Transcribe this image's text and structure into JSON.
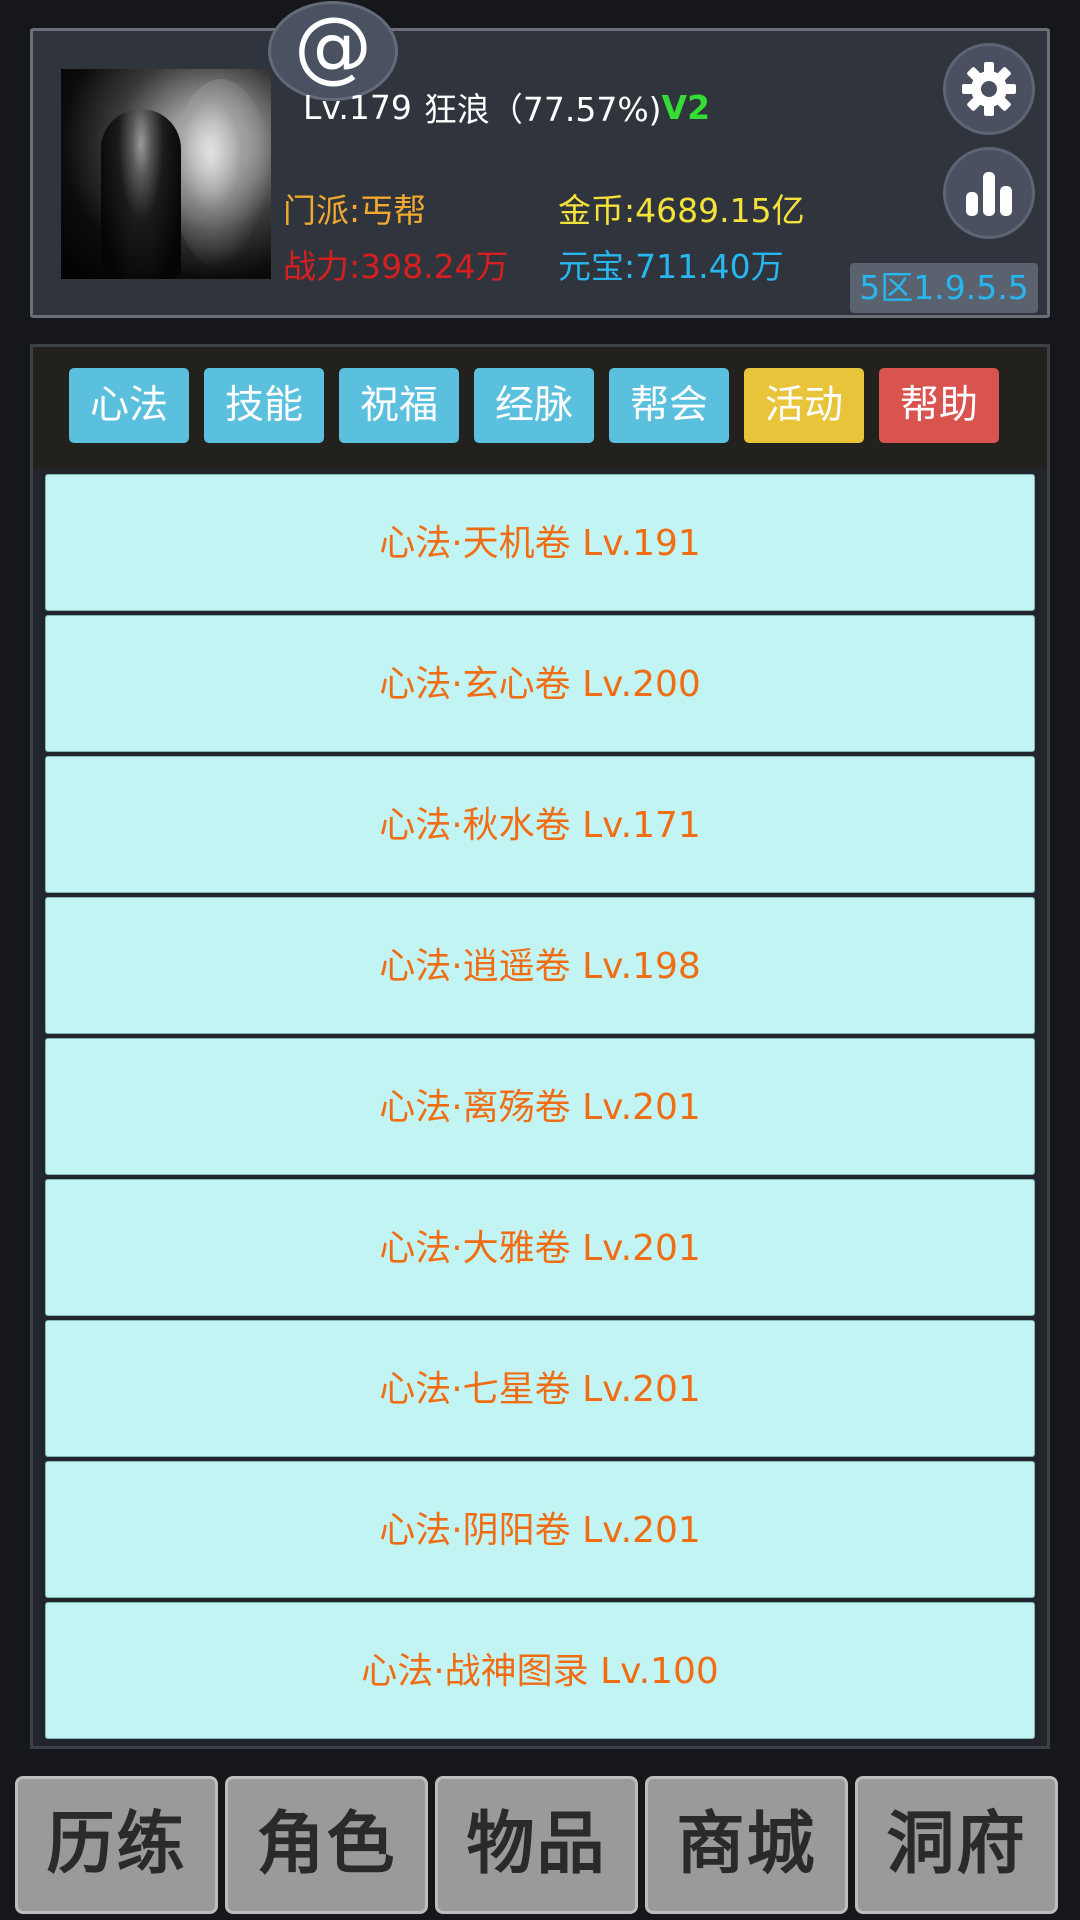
{
  "header": {
    "at_symbol": "@",
    "level": "Lv.179",
    "name": "狂浪",
    "exp_percent": "（77.57%)",
    "vip": "V2",
    "sect": "门派:丐帮",
    "power": "战力:398.24万",
    "gold": "金币:4689.15亿",
    "ingot": "元宝:711.40万",
    "server": "5区1.9.5.5",
    "icons": {
      "settings": "gear-icon",
      "stats": "bar-chart-icon"
    }
  },
  "tabs": [
    {
      "label": "心法",
      "color": "#5bc0de"
    },
    {
      "label": "技能",
      "color": "#5bc0de"
    },
    {
      "label": "祝福",
      "color": "#5bc0de"
    },
    {
      "label": "经脉",
      "color": "#5bc0de"
    },
    {
      "label": "帮会",
      "color": "#5bc0de"
    },
    {
      "label": "活动",
      "color": "#e8c43a"
    },
    {
      "label": "帮助",
      "color": "#d9534f"
    }
  ],
  "skills": [
    "心法·天机卷 Lv.191",
    "心法·玄心卷 Lv.200",
    "心法·秋水卷 Lv.171",
    "心法·逍遥卷 Lv.198",
    "心法·离殇卷 Lv.201",
    "心法·大雅卷 Lv.201",
    "心法·七星卷 Lv.201",
    "心法·阴阳卷 Lv.201",
    "心法·战神图录 Lv.100"
  ],
  "nav": [
    "历练",
    "角色",
    "物品",
    "商城",
    "洞府"
  ],
  "colors": {
    "item_bg": "#c2f4f3",
    "item_text": "#f06d14",
    "vip": "#33dd33",
    "sect": "#f0a830",
    "power": "#d81f1f",
    "gold": "#f3e23a",
    "ingot": "#27b7ee"
  }
}
